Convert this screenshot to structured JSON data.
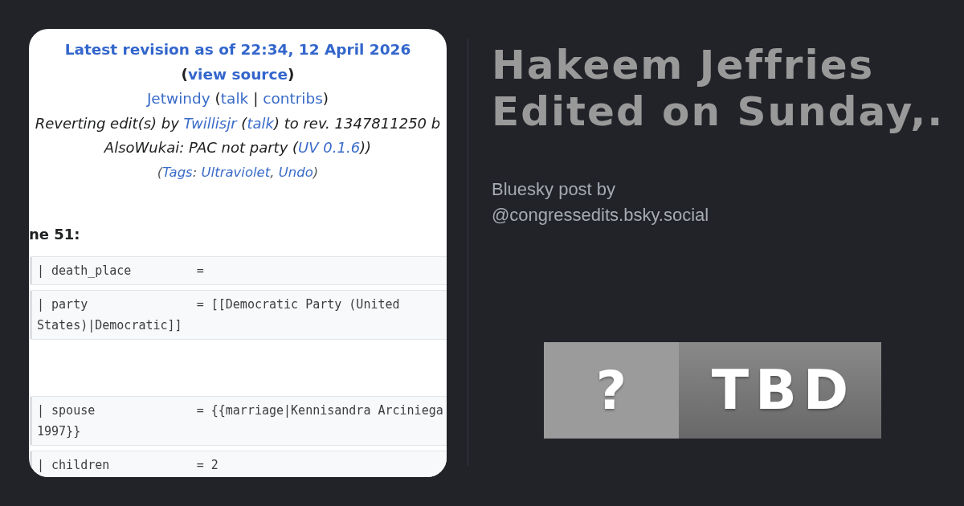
{
  "revision_card": {
    "header": [
      {
        "kind": "link",
        "text": "Latest revision as of 22:34, 12 April 2026"
      },
      {
        "kind": "plain",
        "text": " ("
      },
      {
        "kind": "link",
        "text": "view source"
      },
      {
        "kind": "plain",
        "text": ")"
      }
    ],
    "author": [
      {
        "kind": "link",
        "text": "Jetwindy"
      },
      {
        "kind": "plain",
        "text": " ("
      },
      {
        "kind": "link",
        "text": "talk"
      },
      {
        "kind": "plain",
        "text": " | "
      },
      {
        "kind": "link",
        "text": "contribs"
      },
      {
        "kind": "plain",
        "text": ")"
      }
    ],
    "summary_lines": [
      [
        {
          "kind": "plain",
          "text": "Reverting edit(s) by "
        },
        {
          "kind": "link",
          "text": "Twillisjr"
        },
        {
          "kind": "plain",
          "text": " ("
        },
        {
          "kind": "link",
          "text": "talk"
        },
        {
          "kind": "plain",
          "text": ") to rev. 1347811250 b"
        }
      ],
      [
        {
          "kind": "plain",
          "text": "AlsoWukai: PAC not party ("
        },
        {
          "kind": "link",
          "text": "UV 0.1.6"
        },
        {
          "kind": "plain",
          "text": "))"
        }
      ]
    ],
    "tags": [
      {
        "kind": "plain",
        "text": "("
      },
      {
        "kind": "link",
        "text": "Tags"
      },
      {
        "kind": "plain",
        "text": ": "
      },
      {
        "kind": "link",
        "text": "Ultraviolet"
      },
      {
        "kind": "plain",
        "text": ", "
      },
      {
        "kind": "link",
        "text": "Undo"
      },
      {
        "kind": "plain",
        "text": ")"
      }
    ],
    "line_heading": "ne 51:",
    "diff_blocks": [
      [
        {
          "lines": [
            "| death_place         ="
          ]
        },
        {
          "lines": [
            "| party               = [[Democratic Party (United",
            "States)|Democratic]]"
          ]
        }
      ],
      [
        {
          "lines": [
            "| spouse              = {{marriage|Kennisandra Arciniega",
            "1997}}"
          ]
        },
        {
          "lines": [
            "| children            = 2"
          ]
        }
      ]
    ]
  },
  "post": {
    "title": "Hakeem Jeffries Edited on Sunday,.",
    "byline": "Bluesky post by @congressedits.bsky.social"
  },
  "badge": {
    "symbol": "?",
    "label": "TBD"
  }
}
